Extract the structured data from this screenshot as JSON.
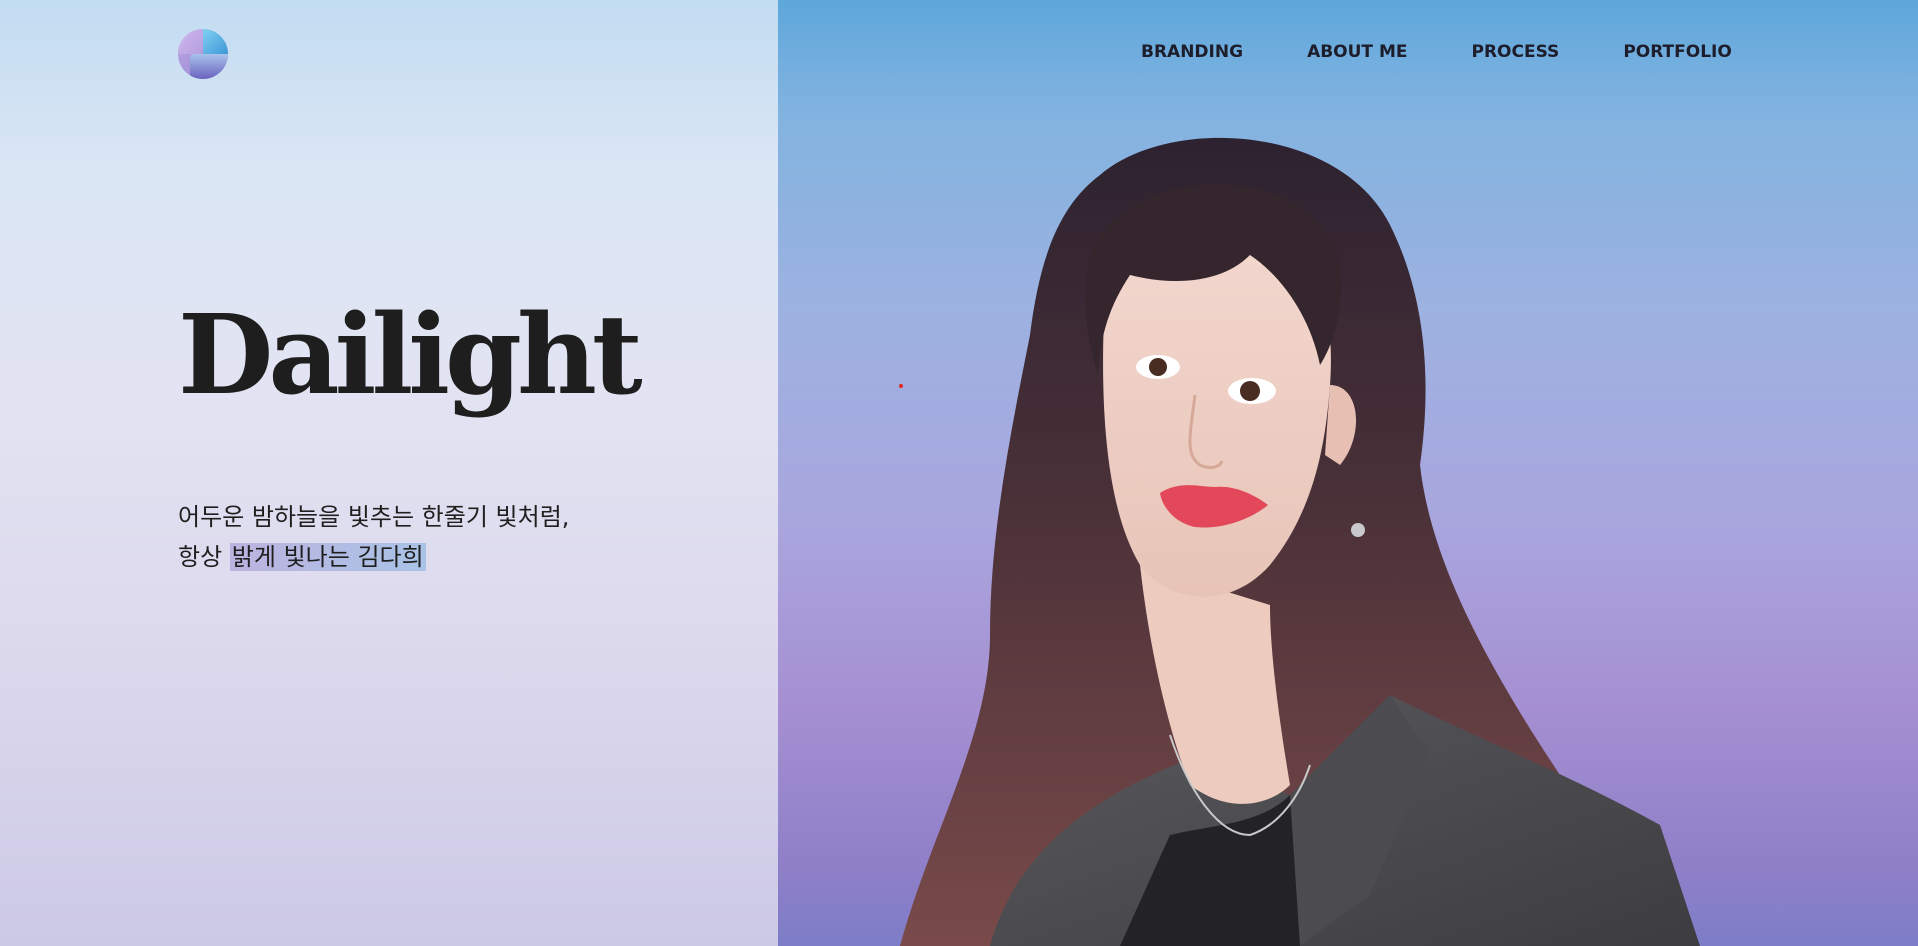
{
  "brand": {
    "logo_icon": "gradient-circle-logo",
    "title": "Dailight"
  },
  "tagline": {
    "line1": "어두운 밤하늘을 빛추는 한줄기 빛처럼,",
    "line2_prefix": "항상 ",
    "line2_highlight": "밝게 빛나는 김다희"
  },
  "nav": {
    "items": [
      {
        "label": "BRANDING"
      },
      {
        "label": "ABOUT ME"
      },
      {
        "label": "PROCESS"
      },
      {
        "label": "PORTFOLIO"
      }
    ]
  },
  "colors": {
    "left_bg_top": "#c2dcf1",
    "left_bg_bottom": "#ccc9e7",
    "right_bg_top": "#5ea7db",
    "right_bg_bottom": "#7d7dc7",
    "text_dark": "#1e1e1e",
    "accent_dot": "#e0281e"
  },
  "hero_image": {
    "icon": "portrait-photo"
  }
}
